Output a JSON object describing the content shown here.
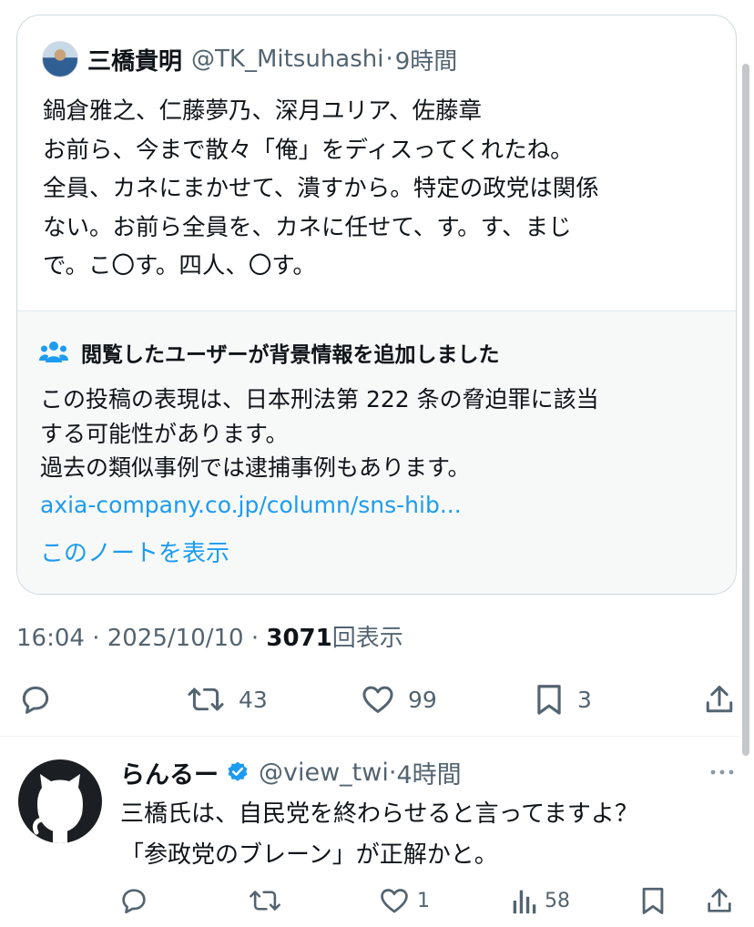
{
  "quoted": {
    "name": "三橋貴明",
    "handle": "@TK_Mitsuhashi",
    "sep": "·",
    "time": "9時間",
    "lines": [
      "鍋倉雅之、仁藤夢乃、深月ユリア、佐藤章",
      "お前ら、今まで散々「俺」をディスってくれたね。",
      "全員、カネにまかせて、潰すから。特定の政党は関係",
      "ない。お前ら全員を、カネに任せて、す。す、まじ",
      "で。こ〇す。四人、〇す。"
    ],
    "note": {
      "title": "閲覧したユーザーが背景情報を追加しました",
      "lines": [
        "この投稿の表現は、日本刑法第 222 条の脅迫罪に該当",
        "する可能性があります。",
        "過去の類似事例では逮捕事例もあります。"
      ],
      "link": "axia-company.co.jp/column/sns-hib...",
      "show_note": "このノートを表示"
    }
  },
  "meta": {
    "time": "16:04 · 2025/10/10 · ",
    "views": "3071",
    "views_label": "回表示"
  },
  "actions": {
    "retweets": "43",
    "likes": "99",
    "bookmarks": "3"
  },
  "reply": {
    "name": "らんるー",
    "handle": "@view_twi",
    "sep": "·",
    "time": "4時間",
    "lines": [
      "三橋氏は、自民党を終わらせると言ってますよ？",
      "「参政党のブレーン」が正解かと。"
    ],
    "actions": {
      "likes": "1",
      "views": "58"
    }
  },
  "colors": {
    "link": "#1d9bf0",
    "secondary_text": "#536471",
    "primary_text": "#0f1419",
    "note_bg": "#f7f9f9",
    "verified": "#1d9bf0"
  },
  "icons": [
    "reply-icon",
    "retweet-icon",
    "like-icon",
    "bookmark-icon",
    "share-icon",
    "people-icon",
    "verified-icon",
    "views-icon",
    "more-icon"
  ]
}
